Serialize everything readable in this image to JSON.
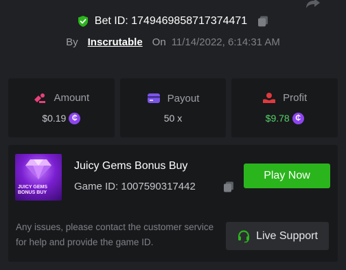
{
  "header": {
    "bet_id_label": "Bet ID: 1749469858717374471",
    "by_label": "By",
    "username": "Inscrutable",
    "on_label": "On",
    "date": "11/14/2022, 6:14:31 AM"
  },
  "stats": {
    "amount": {
      "label": "Amount",
      "value": "$0.19"
    },
    "payout": {
      "label": "Payout",
      "value": "50 x"
    },
    "profit": {
      "label": "Profit",
      "value": "$9.78"
    },
    "coin_symbol": "₵"
  },
  "game": {
    "name": "Juicy Gems Bonus Buy",
    "id_label": "Game ID: 1007590317442",
    "thumbnail_title": "JUICY GEMS BONUS BUY",
    "play_button": "Play Now"
  },
  "support": {
    "notice": "Any issues, please contact the customer service for help and provide the game ID.",
    "button": "Live Support"
  },
  "colors": {
    "background": "#202124",
    "card": "#18191b",
    "accent_green": "#2bb51d",
    "profit_green": "#54d36b",
    "coin_purple": "#8d45ef",
    "amount_pink": "#e8417a",
    "payout_purple": "#7b55e8",
    "profit_red": "#e0393e"
  },
  "icons": [
    "share-icon",
    "shield-check-icon",
    "copy-icon",
    "amount-icon",
    "payout-card-icon",
    "profit-icon",
    "headset-icon",
    "coin-icon"
  ]
}
